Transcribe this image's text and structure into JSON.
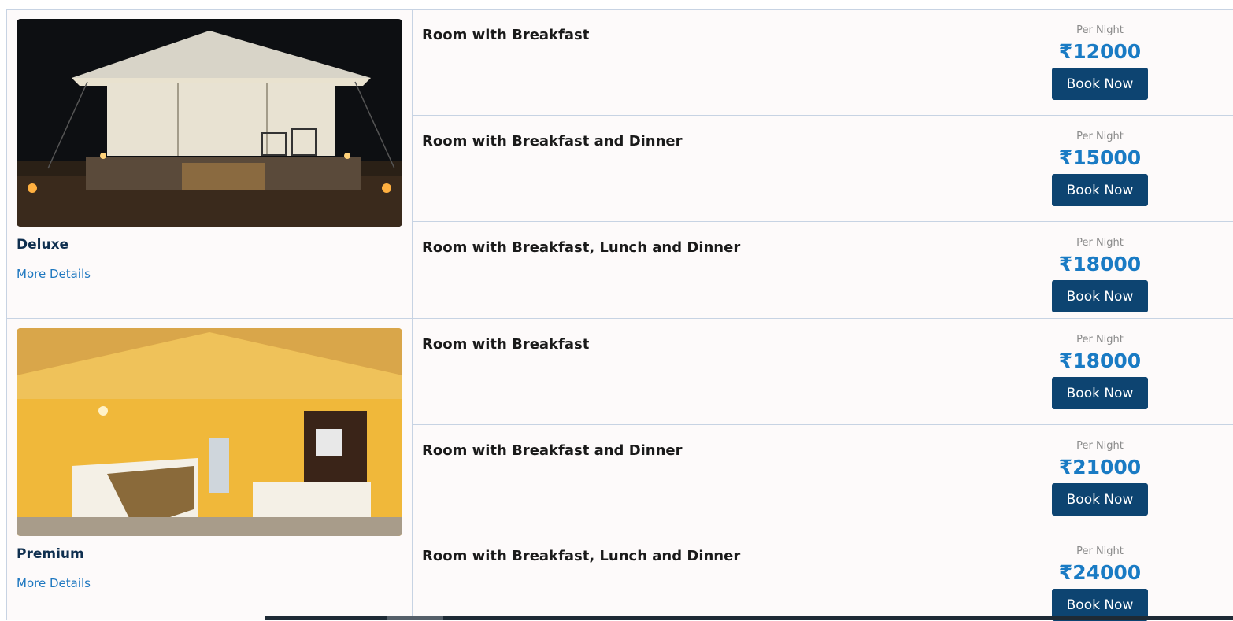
{
  "rooms": [
    {
      "name": "Deluxe",
      "more_details": "More Details",
      "photo_icon": "tent-night-photo",
      "plans": [
        {
          "title": "Room with Breakfast",
          "per_night": "Per Night",
          "currency": "₹",
          "price": "12000",
          "button": "Book Now"
        },
        {
          "title": "Room with Breakfast and Dinner",
          "per_night": "Per Night",
          "currency": "₹",
          "price": "15000",
          "button": "Book Now"
        },
        {
          "title": "Room with Breakfast, Lunch and Dinner",
          "per_night": "Per Night",
          "currency": "₹",
          "price": "18000",
          "button": "Book Now"
        }
      ]
    },
    {
      "name": "Premium",
      "more_details": "More Details",
      "photo_icon": "tent-interior-photo",
      "plans": [
        {
          "title": "Room with Breakfast",
          "per_night": "Per Night",
          "currency": "₹",
          "price": "18000",
          "button": "Book Now"
        },
        {
          "title": "Room with Breakfast and Dinner",
          "per_night": "Per Night",
          "currency": "₹",
          "price": "21000",
          "button": "Book Now"
        },
        {
          "title": "Room with Breakfast, Lunch and Dinner",
          "per_night": "Per Night",
          "currency": "₹",
          "price": "24000",
          "button": "Book Now"
        }
      ]
    }
  ],
  "colors": {
    "accent_price": "#1a7bc4",
    "button_bg": "#0d4471",
    "room_name": "#0f2f4f",
    "link": "#1f78c0",
    "border": "#c7d3e3"
  }
}
